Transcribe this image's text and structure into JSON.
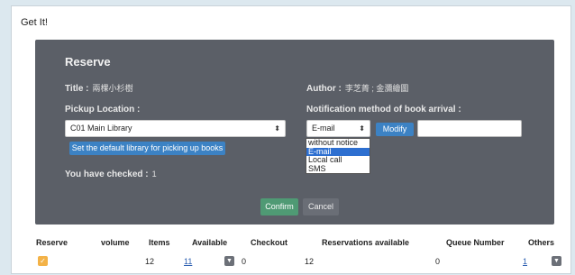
{
  "card": {
    "title": "Get It!"
  },
  "panel": {
    "heading": "Reserve",
    "title_label": "Title :",
    "title_value": "兩棵小杉樹",
    "author_label": "Author :",
    "author_value": "李芝菁 ; 金瀰繪圖",
    "pickup_label": "Pickup Location :",
    "pickup_selected": "C01 Main Library",
    "default_library_button": "Set the default library for picking up books",
    "notify_label": "Notification method of book arrival :",
    "notify_selected": "E-mail",
    "notify_options": [
      "without notice",
      "E-mail",
      "Local call",
      "SMS"
    ],
    "modify_button": "Modify",
    "checked_label": "You have checked :",
    "checked_count": "1",
    "confirm_button": "Confirm",
    "cancel_button": "Cancel"
  },
  "table": {
    "headers": [
      "Reserve",
      "volume",
      "Items",
      "Available",
      "Checkout",
      "Reservations available",
      "Queue Number",
      "Others"
    ],
    "row": {
      "volume": "",
      "items": "12",
      "available": "11",
      "checkout": "0",
      "reservations_available": "12",
      "queue_number": "0",
      "others": "1"
    }
  }
}
